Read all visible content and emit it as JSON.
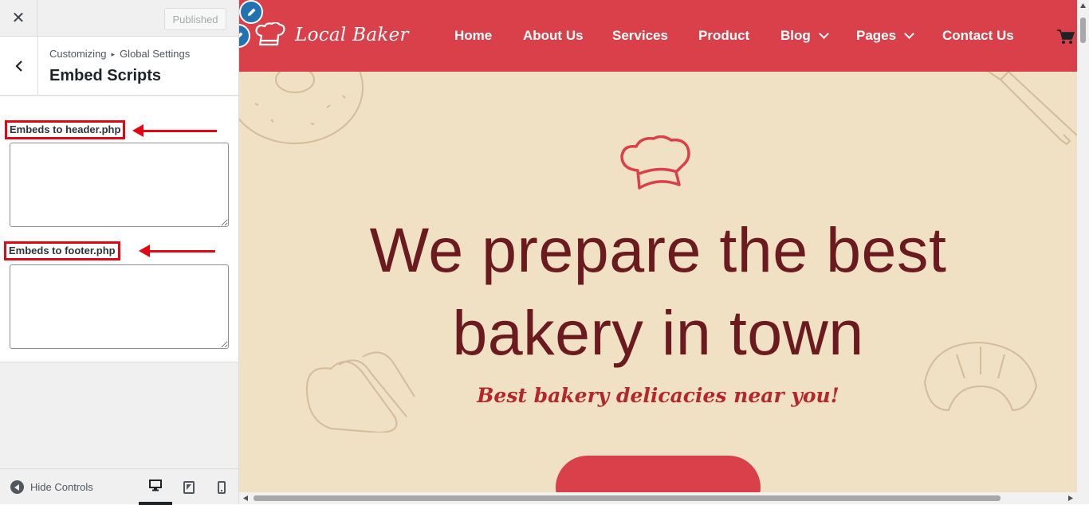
{
  "customizer": {
    "close_label": "✕",
    "publish_label": "Published",
    "breadcrumb": [
      "Customizing",
      "Global Settings"
    ],
    "breadcrumb_sep": "▸",
    "section_title": "Embed Scripts",
    "fields": [
      {
        "label": "Embeds to header.php",
        "value": ""
      },
      {
        "label": "Embeds to footer.php",
        "value": ""
      }
    ],
    "hide_controls_label": "Hide Controls",
    "devices": [
      "desktop-icon",
      "tablet-icon",
      "mobile-icon"
    ],
    "active_device": "desktop"
  },
  "site": {
    "logo_text": "Local Baker",
    "nav": [
      {
        "label": "Home",
        "dropdown": false
      },
      {
        "label": "About Us",
        "dropdown": false
      },
      {
        "label": "Services",
        "dropdown": false
      },
      {
        "label": "Product",
        "dropdown": false
      },
      {
        "label": "Blog",
        "dropdown": true
      },
      {
        "label": "Pages",
        "dropdown": true
      },
      {
        "label": "Contact Us",
        "dropdown": false
      }
    ],
    "hero_title_line1": "We prepare the best",
    "hero_title_line2": "bakery in town",
    "hero_subtitle": "Best bakery delicacies near you!",
    "colors": {
      "header": "#d9404a",
      "hero_bg": "#f0e0c4",
      "title": "#6b1a1f",
      "subtitle": "#b3282f"
    }
  }
}
